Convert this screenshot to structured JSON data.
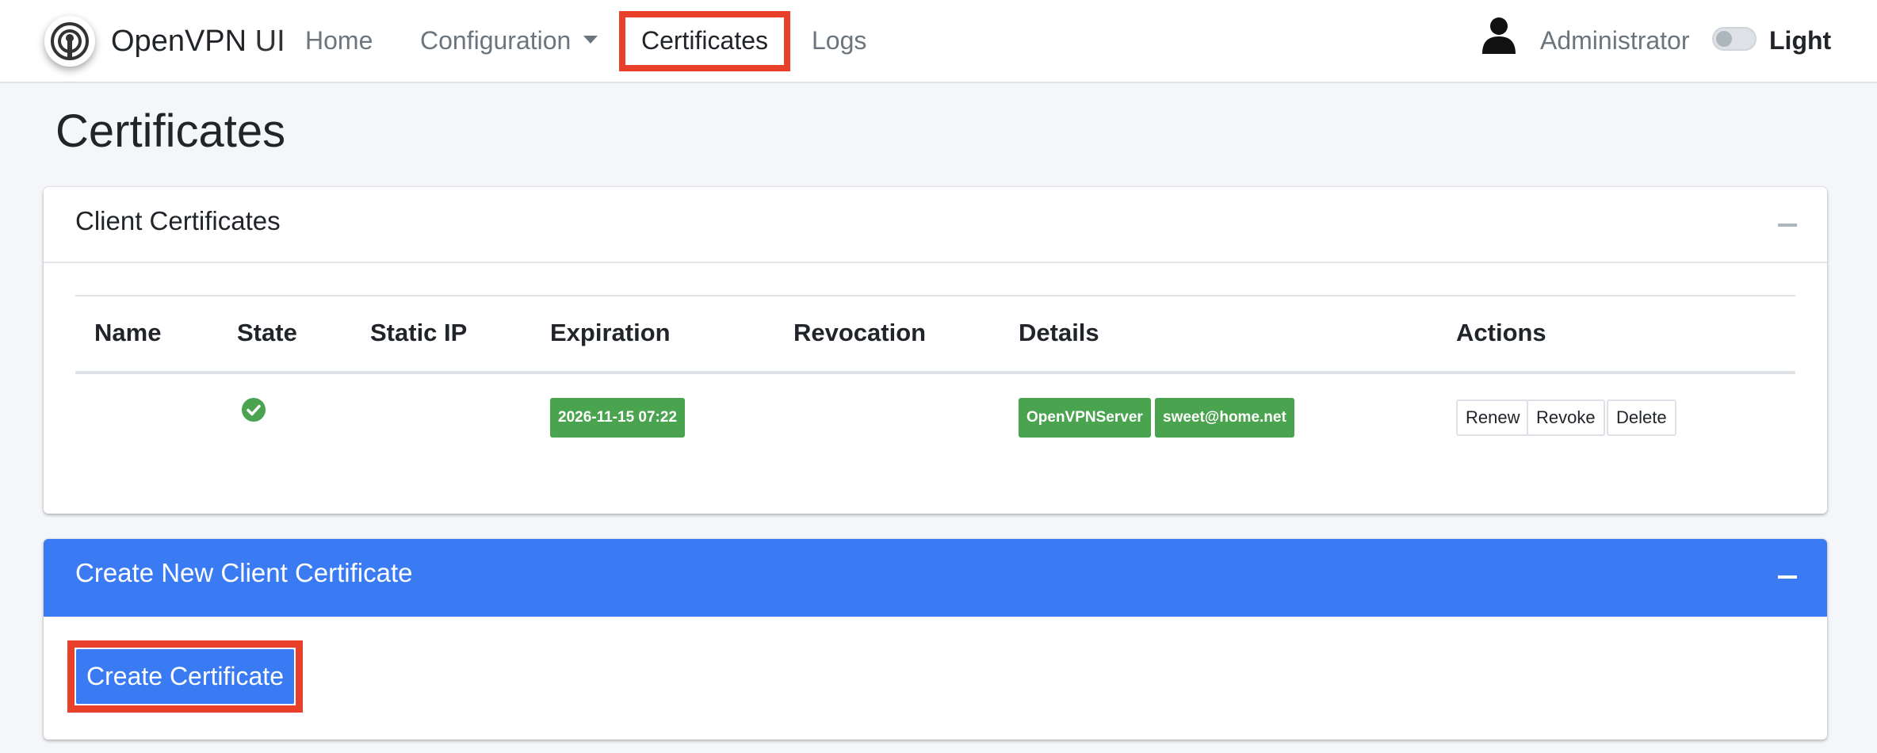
{
  "brand": {
    "name": "OpenVPN",
    "suffix": "UI"
  },
  "nav": {
    "home": "Home",
    "configuration": "Configuration",
    "certificates": "Certificates",
    "logs": "Logs"
  },
  "user": {
    "name": "Administrator"
  },
  "theme": {
    "label": "Light",
    "dark_mode": false
  },
  "page": {
    "title": "Certificates"
  },
  "client_certificates": {
    "title": "Client Certificates",
    "columns": [
      "Name",
      "State",
      "Static IP",
      "Expiration",
      "Revocation",
      "Details",
      "Actions"
    ],
    "rows": [
      {
        "name": "",
        "state": "valid",
        "static_ip": "",
        "expiration": "2026-11-15 07:22",
        "revocation": "",
        "details": [
          "OpenVPNServer",
          "sweet@home.net"
        ],
        "actions": [
          "Renew",
          "Revoke",
          "Delete"
        ]
      }
    ]
  },
  "create_card": {
    "title": "Create New Client Certificate",
    "button": "Create Certificate"
  },
  "colors": {
    "accent": "#3a7bf3",
    "success": "#4aa34e",
    "highlight": "#e8402a"
  }
}
